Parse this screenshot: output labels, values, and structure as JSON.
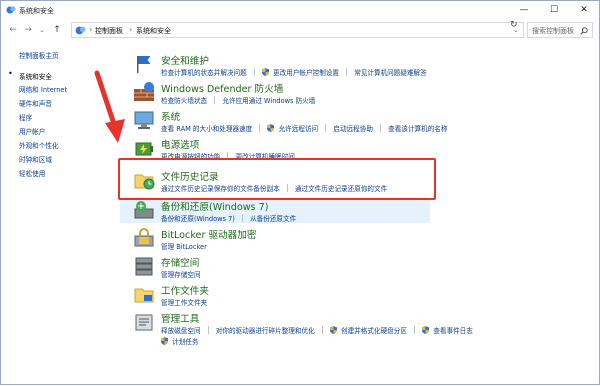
{
  "window": {
    "title": "系统和安全",
    "minimize": "—",
    "maximize": "☐",
    "close": "✕"
  },
  "addressbar": {
    "back": "←",
    "forward": "→",
    "recent": "⌄",
    "up": "↑",
    "crumbs": [
      "控制面板",
      "系统和安全"
    ],
    "dropdown": "⌄",
    "refresh": "↻",
    "search_placeholder": "搜索控制面板",
    "search_icon": "search-icon"
  },
  "sidebar": {
    "items": [
      {
        "label": "控制面板主页",
        "current": false
      },
      {
        "label": "系统和安全",
        "current": true
      },
      {
        "label": "网络和 Internet",
        "current": false
      },
      {
        "label": "硬件和声音",
        "current": false
      },
      {
        "label": "程序",
        "current": false
      },
      {
        "label": "用户帐户",
        "current": false
      },
      {
        "label": "外观和个性化",
        "current": false
      },
      {
        "label": "时钟和区域",
        "current": false
      },
      {
        "label": "轻松使用",
        "current": false
      }
    ]
  },
  "categories": [
    {
      "id": "security-maintenance",
      "heading": "安全和维护",
      "icon": "flag-icon",
      "links": [
        "检查计算机的状态并解决问题",
        "更改用户帐户控制设置",
        "常见计算机问题疑难解答"
      ]
    },
    {
      "id": "defender-firewall",
      "heading": "Windows Defender 防火墙",
      "icon": "firewall-icon",
      "links": [
        "检查防火墙状态",
        "允许应用通过 Windows 防火墙"
      ]
    },
    {
      "id": "system",
      "heading": "系统",
      "icon": "computer-icon",
      "links": [
        "查看 RAM 的大小和处理器速度",
        "允许远程访问",
        "启动远程协助",
        "查看该计算机的名称"
      ]
    },
    {
      "id": "power",
      "heading": "电源选项",
      "icon": "battery-icon",
      "links": [
        "更改电源按钮的功能",
        "更改计算机睡眠时间"
      ]
    },
    {
      "id": "file-history",
      "heading": "文件历史记录",
      "icon": "folder-clock-icon",
      "links": [
        "通过文件历史记录保存你的文件备份副本",
        "通过文件历史记录还原你的文件"
      ]
    },
    {
      "id": "backup-restore",
      "heading": "备份和还原(Windows 7)",
      "icon": "backup-icon",
      "links": [
        "备份和还原(Windows 7)",
        "从备份还原文件"
      ]
    },
    {
      "id": "bitlocker",
      "heading": "BitLocker 驱动器加密",
      "icon": "bitlocker-icon",
      "links": [
        "管理 BitLocker"
      ]
    },
    {
      "id": "storage-spaces",
      "heading": "存储空间",
      "icon": "storage-icon",
      "links": [
        "管理存储空间"
      ]
    },
    {
      "id": "work-folders",
      "heading": "工作文件夹",
      "icon": "work-folder-icon",
      "links": [
        "管理工作文件夹"
      ]
    },
    {
      "id": "admin-tools",
      "heading": "管理工具",
      "icon": "admin-tools-icon",
      "links": [
        "释放磁盘空间",
        "对你的驱动器进行碎片整理和优化",
        "创建并格式化硬盘分区",
        "查看事件日志",
        "计划任务"
      ]
    }
  ],
  "colors": {
    "heading_green": "#1e6b18",
    "link_blue": "#0b3d8c",
    "annotation_red": "#e8322c",
    "hover_blue": "#e5f1fb"
  }
}
